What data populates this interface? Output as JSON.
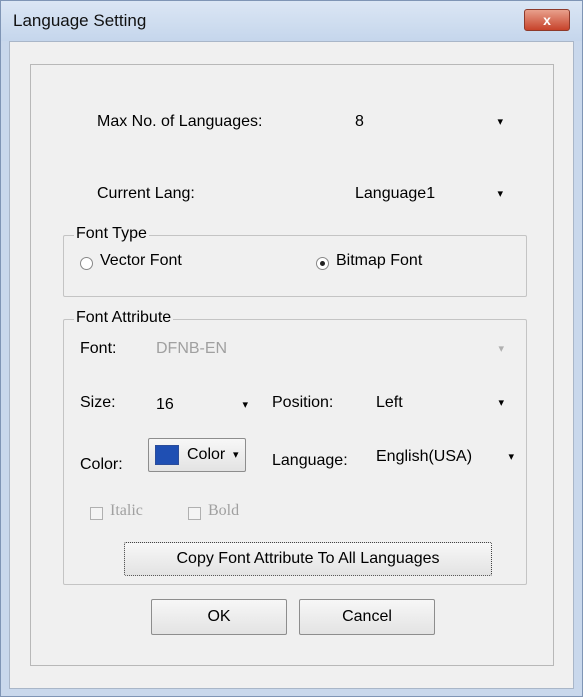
{
  "window": {
    "title": "Language Setting",
    "close_label": "x"
  },
  "max_languages": {
    "label": "Max No. of Languages:",
    "value": "8"
  },
  "current_lang": {
    "label": "Current Lang:",
    "value": "Language1"
  },
  "font_type": {
    "legend": "Font Type",
    "vector_label": "Vector Font",
    "bitmap_label": "Bitmap Font",
    "selected": "bitmap"
  },
  "font_attribute": {
    "legend": "Font Attribute",
    "font_label": "Font:",
    "font_value": "DFNB-EN",
    "size_label": "Size:",
    "size_value": "16",
    "position_label": "Position:",
    "position_value": "Left",
    "color_label": "Color:",
    "color_button_label": "Color",
    "color_value": "#1f4fb3",
    "language_label": "Language:",
    "language_value": "English(USA)",
    "italic_label": "Italic",
    "bold_label": "Bold",
    "copy_button_label": "Copy Font Attribute To All Languages"
  },
  "buttons": {
    "ok_label": "OK",
    "cancel_label": "Cancel"
  },
  "icons": {
    "dropdown": "▾"
  }
}
